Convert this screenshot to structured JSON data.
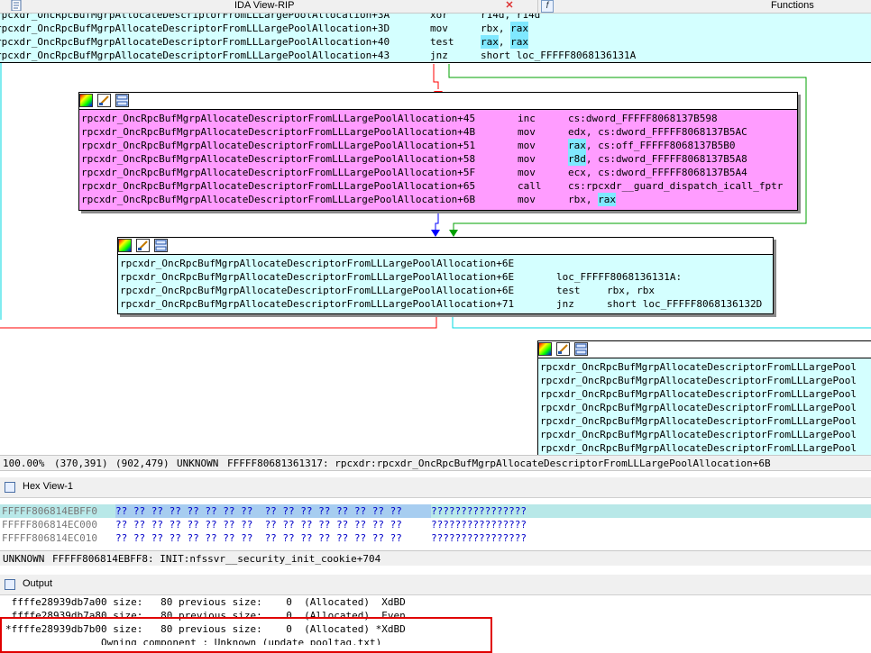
{
  "tabs": {
    "ida_view": {
      "title": "IDA View-RIP"
    },
    "functions": {
      "title": "Functions",
      "icon": "f"
    }
  },
  "top_block": {
    "rows": [
      {
        "addr": "rpcxdr_OncRpcBufMgrpAllocateDescriptorFromLLLargePoolAllocation+3A",
        "mn": "xor",
        "op1": "r14d",
        "sep": ", ",
        "op2": "r14d",
        "hl1": false,
        "hl2": false
      },
      {
        "addr": "rpcxdr_OncRpcBufMgrpAllocateDescriptorFromLLLargePoolAllocation+3D",
        "mn": "mov",
        "op1": "rbx",
        "sep": ", ",
        "op2": "rax",
        "hl1": false,
        "hl2": true
      },
      {
        "addr": "rpcxdr_OncRpcBufMgrpAllocateDescriptorFromLLLargePoolAllocation+40",
        "mn": "test",
        "op1": "rax",
        "sep": ", ",
        "op2": "rax",
        "hl1": true,
        "hl2": true
      },
      {
        "addr": "rpcxdr_OncRpcBufMgrpAllocateDescriptorFromLLLargePoolAllocation+43",
        "mn": "jnz",
        "op1": "short loc_FFFFF8068136131A",
        "sep": "",
        "op2": "",
        "hl1": false,
        "hl2": false
      }
    ]
  },
  "pink_block": {
    "rows": [
      {
        "addr": "rpcxdr_OncRpcBufMgrpAllocateDescriptorFromLLLargePoolAllocation+45",
        "mn": "inc",
        "op1": "cs:dword_FFFFF8068137B598",
        "sep": "",
        "op2": "",
        "hl1": false,
        "hl2": false
      },
      {
        "addr": "rpcxdr_OncRpcBufMgrpAllocateDescriptorFromLLLargePoolAllocation+4B",
        "mn": "mov",
        "op1": "edx",
        "sep": ", ",
        "op2": "cs:dword_FFFFF8068137B5AC",
        "hl1": false,
        "hl2": false
      },
      {
        "addr": "rpcxdr_OncRpcBufMgrpAllocateDescriptorFromLLLargePoolAllocation+51",
        "mn": "mov",
        "op1": "rax",
        "sep": ", ",
        "op2": "cs:off_FFFFF8068137B5B0",
        "hl1": true,
        "hl2": false
      },
      {
        "addr": "rpcxdr_OncRpcBufMgrpAllocateDescriptorFromLLLargePoolAllocation+58",
        "mn": "mov",
        "op1": "r8d",
        "sep": ", ",
        "op2": "cs:dword_FFFFF8068137B5A8",
        "hl1": true,
        "hl2": false
      },
      {
        "addr": "rpcxdr_OncRpcBufMgrpAllocateDescriptorFromLLLargePoolAllocation+5F",
        "mn": "mov",
        "op1": "ecx",
        "sep": ", ",
        "op2": "cs:dword_FFFFF8068137B5A4",
        "hl1": false,
        "hl2": false
      },
      {
        "addr": "rpcxdr_OncRpcBufMgrpAllocateDescriptorFromLLLargePoolAllocation+65",
        "mn": "call",
        "op1": "cs:rpcxdr__guard_dispatch_icall_fptr",
        "sep": "",
        "op2": "",
        "hl1": false,
        "hl2": false
      },
      {
        "addr": "rpcxdr_OncRpcBufMgrpAllocateDescriptorFromLLLargePoolAllocation+6B",
        "mn": "mov",
        "op1": "rbx",
        "sep": ", ",
        "op2": "rax",
        "hl1": false,
        "hl2": true
      }
    ]
  },
  "loc_block": {
    "rows": [
      {
        "addr": "rpcxdr_OncRpcBufMgrpAllocateDescriptorFromLLLargePoolAllocation+6E",
        "mn": "",
        "op1": "",
        "sep": "",
        "op2": "",
        "hl1": false,
        "hl2": false
      },
      {
        "addr": "rpcxdr_OncRpcBufMgrpAllocateDescriptorFromLLLargePoolAllocation+6E",
        "mn": "loc_FFFFF8068136131A:",
        "op1": "",
        "sep": "",
        "op2": "",
        "hl1": false,
        "hl2": false
      },
      {
        "addr": "rpcxdr_OncRpcBufMgrpAllocateDescriptorFromLLLargePoolAllocation+6E",
        "mn": "test",
        "op1": "rbx",
        "sep": ", ",
        "op2": "rbx",
        "hl1": false,
        "hl2": false
      },
      {
        "addr": "rpcxdr_OncRpcBufMgrpAllocateDescriptorFromLLLargePoolAllocation+71",
        "mn": "jnz",
        "op1": "short loc_FFFFF8068136132D",
        "sep": "",
        "op2": "",
        "hl1": false,
        "hl2": false
      }
    ]
  },
  "right_block": {
    "rows": [
      "rpcxdr_OncRpcBufMgrpAllocateDescriptorFromLLLargePool",
      "rpcxdr_OncRpcBufMgrpAllocateDescriptorFromLLLargePool",
      "rpcxdr_OncRpcBufMgrpAllocateDescriptorFromLLLargePool",
      "rpcxdr_OncRpcBufMgrpAllocateDescriptorFromLLLargePool",
      "rpcxdr_OncRpcBufMgrpAllocateDescriptorFromLLLargePool",
      "rpcxdr_OncRpcBufMgrpAllocateDescriptorFromLLLargePool",
      "rpcxdr_OncRpcBufMgrpAllocateDescriptorFromLLLargePool"
    ]
  },
  "status": {
    "zoom": "100.00%",
    "coords1": "(370,391)",
    "coords2": "(902,479)",
    "seg": "UNKNOWN",
    "location": "FFFFF80681361317: rpcxdr:rpcxdr_OncRpcBufMgrpAllocateDescriptorFromLLLargePoolAllocation+6B"
  },
  "hex_view": {
    "title": "Hex View-1",
    "rows": [
      {
        "addr": "FFFFF806814EBFF0",
        "bytes": "?? ?? ?? ?? ?? ?? ?? ??  ?? ?? ?? ?? ?? ?? ?? ??",
        "ascii": "????????????????",
        "selected": true
      },
      {
        "addr": "FFFFF806814EC000",
        "bytes": "?? ?? ?? ?? ?? ?? ?? ??  ?? ?? ?? ?? ?? ?? ?? ??",
        "ascii": "????????????????",
        "selected": false
      },
      {
        "addr": "FFFFF806814EC010",
        "bytes": "?? ?? ?? ?? ?? ?? ?? ??  ?? ?? ?? ?? ?? ?? ?? ??",
        "ascii": "????????????????",
        "selected": false
      }
    ],
    "status_seg": "UNKNOWN",
    "status_loc": "FFFFF806814EBFF8: INIT:nfssvr__security_init_cookie+704"
  },
  "output": {
    "title": "Output",
    "lines": [
      " ffffe28939db7a00 size:   80 previous size:    0  (Allocated)  XdBD",
      " ffffe28939db7a80 size:   80 previous size:    0  (Allocated)  Even",
      "*ffffe28939db7b00 size:   80 previous size:    0  (Allocated) *XdBD",
      "                Owning component : Unknown (update pooltag.txt)"
    ]
  },
  "colors": {
    "cyan_block": "#d4ffff",
    "pink_block": "#ff9cff",
    "highlight": "#7fe8ff",
    "edge_red": "#ff0000",
    "edge_green": "#00a000",
    "edge_blue": "#0000ff",
    "edge_cyan": "#00d8e0"
  }
}
